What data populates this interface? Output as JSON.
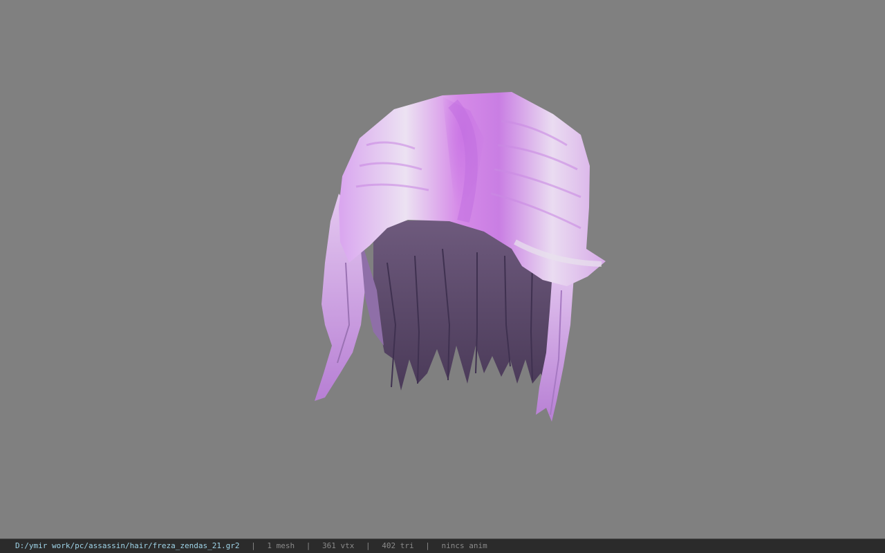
{
  "viewer": {
    "background_color": "#808080",
    "model": {
      "name": "hair-mesh",
      "hair_color": "#d08be8",
      "highlight_color": "#f2eef5",
      "under_color": "#5f4b6e"
    }
  },
  "status_bar": {
    "file_path": "D:/ymir work/pc/assassin/hair/freza_zendas_21.gr2",
    "separator": "|",
    "mesh_count": "1 mesh",
    "vertex_count": "361 vtx",
    "triangle_count": "402 tri",
    "anim_status": "nincs anim"
  }
}
